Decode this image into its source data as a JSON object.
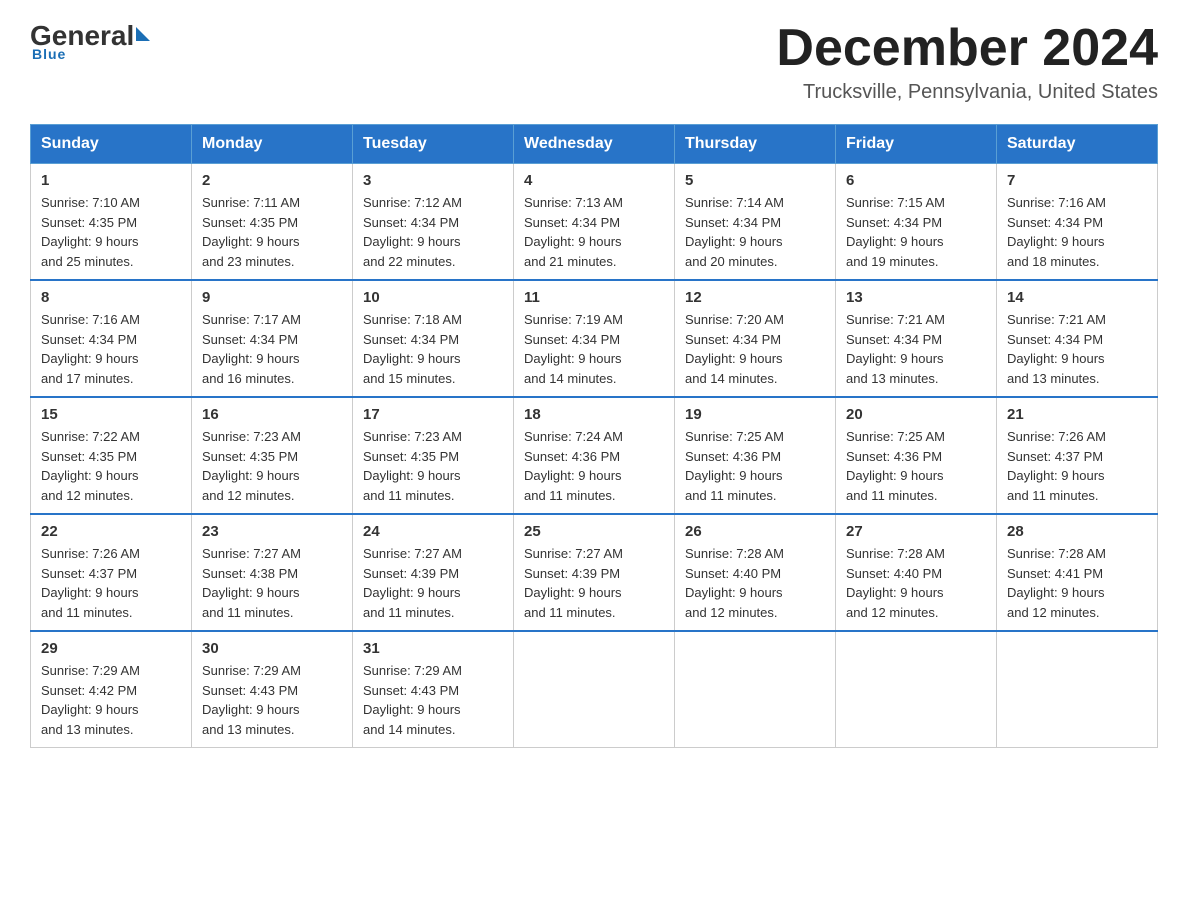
{
  "logo": {
    "general": "General",
    "blue": "Blue",
    "underline": "Blue"
  },
  "title": "December 2024",
  "subtitle": "Trucksville, Pennsylvania, United States",
  "headers": [
    "Sunday",
    "Monday",
    "Tuesday",
    "Wednesday",
    "Thursday",
    "Friday",
    "Saturday"
  ],
  "weeks": [
    [
      {
        "day": "1",
        "sunrise": "7:10 AM",
        "sunset": "4:35 PM",
        "daylight": "9 hours and 25 minutes."
      },
      {
        "day": "2",
        "sunrise": "7:11 AM",
        "sunset": "4:35 PM",
        "daylight": "9 hours and 23 minutes."
      },
      {
        "day": "3",
        "sunrise": "7:12 AM",
        "sunset": "4:34 PM",
        "daylight": "9 hours and 22 minutes."
      },
      {
        "day": "4",
        "sunrise": "7:13 AM",
        "sunset": "4:34 PM",
        "daylight": "9 hours and 21 minutes."
      },
      {
        "day": "5",
        "sunrise": "7:14 AM",
        "sunset": "4:34 PM",
        "daylight": "9 hours and 20 minutes."
      },
      {
        "day": "6",
        "sunrise": "7:15 AM",
        "sunset": "4:34 PM",
        "daylight": "9 hours and 19 minutes."
      },
      {
        "day": "7",
        "sunrise": "7:16 AM",
        "sunset": "4:34 PM",
        "daylight": "9 hours and 18 minutes."
      }
    ],
    [
      {
        "day": "8",
        "sunrise": "7:16 AM",
        "sunset": "4:34 PM",
        "daylight": "9 hours and 17 minutes."
      },
      {
        "day": "9",
        "sunrise": "7:17 AM",
        "sunset": "4:34 PM",
        "daylight": "9 hours and 16 minutes."
      },
      {
        "day": "10",
        "sunrise": "7:18 AM",
        "sunset": "4:34 PM",
        "daylight": "9 hours and 15 minutes."
      },
      {
        "day": "11",
        "sunrise": "7:19 AM",
        "sunset": "4:34 PM",
        "daylight": "9 hours and 14 minutes."
      },
      {
        "day": "12",
        "sunrise": "7:20 AM",
        "sunset": "4:34 PM",
        "daylight": "9 hours and 14 minutes."
      },
      {
        "day": "13",
        "sunrise": "7:21 AM",
        "sunset": "4:34 PM",
        "daylight": "9 hours and 13 minutes."
      },
      {
        "day": "14",
        "sunrise": "7:21 AM",
        "sunset": "4:34 PM",
        "daylight": "9 hours and 13 minutes."
      }
    ],
    [
      {
        "day": "15",
        "sunrise": "7:22 AM",
        "sunset": "4:35 PM",
        "daylight": "9 hours and 12 minutes."
      },
      {
        "day": "16",
        "sunrise": "7:23 AM",
        "sunset": "4:35 PM",
        "daylight": "9 hours and 12 minutes."
      },
      {
        "day": "17",
        "sunrise": "7:23 AM",
        "sunset": "4:35 PM",
        "daylight": "9 hours and 11 minutes."
      },
      {
        "day": "18",
        "sunrise": "7:24 AM",
        "sunset": "4:36 PM",
        "daylight": "9 hours and 11 minutes."
      },
      {
        "day": "19",
        "sunrise": "7:25 AM",
        "sunset": "4:36 PM",
        "daylight": "9 hours and 11 minutes."
      },
      {
        "day": "20",
        "sunrise": "7:25 AM",
        "sunset": "4:36 PM",
        "daylight": "9 hours and 11 minutes."
      },
      {
        "day": "21",
        "sunrise": "7:26 AM",
        "sunset": "4:37 PM",
        "daylight": "9 hours and 11 minutes."
      }
    ],
    [
      {
        "day": "22",
        "sunrise": "7:26 AM",
        "sunset": "4:37 PM",
        "daylight": "9 hours and 11 minutes."
      },
      {
        "day": "23",
        "sunrise": "7:27 AM",
        "sunset": "4:38 PM",
        "daylight": "9 hours and 11 minutes."
      },
      {
        "day": "24",
        "sunrise": "7:27 AM",
        "sunset": "4:39 PM",
        "daylight": "9 hours and 11 minutes."
      },
      {
        "day": "25",
        "sunrise": "7:27 AM",
        "sunset": "4:39 PM",
        "daylight": "9 hours and 11 minutes."
      },
      {
        "day": "26",
        "sunrise": "7:28 AM",
        "sunset": "4:40 PM",
        "daylight": "9 hours and 12 minutes."
      },
      {
        "day": "27",
        "sunrise": "7:28 AM",
        "sunset": "4:40 PM",
        "daylight": "9 hours and 12 minutes."
      },
      {
        "day": "28",
        "sunrise": "7:28 AM",
        "sunset": "4:41 PM",
        "daylight": "9 hours and 12 minutes."
      }
    ],
    [
      {
        "day": "29",
        "sunrise": "7:29 AM",
        "sunset": "4:42 PM",
        "daylight": "9 hours and 13 minutes."
      },
      {
        "day": "30",
        "sunrise": "7:29 AM",
        "sunset": "4:43 PM",
        "daylight": "9 hours and 13 minutes."
      },
      {
        "day": "31",
        "sunrise": "7:29 AM",
        "sunset": "4:43 PM",
        "daylight": "9 hours and 14 minutes."
      },
      null,
      null,
      null,
      null
    ]
  ],
  "labels": {
    "sunrise": "Sunrise:",
    "sunset": "Sunset:",
    "daylight": "Daylight:"
  }
}
